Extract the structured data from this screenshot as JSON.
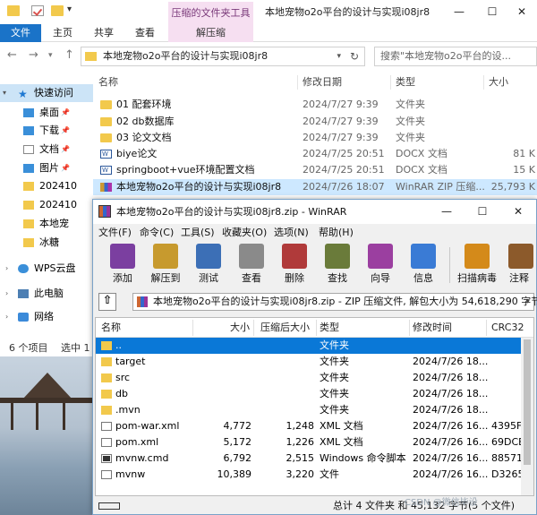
{
  "explorer": {
    "title": "本地宠物o2o平台的设计与实现i08jr8",
    "ribbon": {
      "context_title": "压缩的文件夹工具",
      "tabs": [
        "文件",
        "主页",
        "共享",
        "查看",
        "解压缩"
      ]
    },
    "address": {
      "path": "本地宠物o2o平台的设计与实现i08jr8"
    },
    "search_placeholder": "搜索\"本地宠物o2o平台的设...",
    "nav_items": [
      {
        "label": "快速访问",
        "icon": "star-icon",
        "pinned": false
      },
      {
        "label": "桌面",
        "icon": "desktop-icon",
        "pinned": true
      },
      {
        "label": "下载",
        "icon": "download-icon",
        "pinned": true
      },
      {
        "label": "文档",
        "icon": "document-icon",
        "pinned": true
      },
      {
        "label": "图片",
        "icon": "picture-icon",
        "pinned": true
      },
      {
        "label": "202410",
        "icon": "folder-icon",
        "pinned": false
      },
      {
        "label": "202410",
        "icon": "folder-icon",
        "pinned": false
      },
      {
        "label": "本地宠",
        "icon": "folder-icon",
        "pinned": false
      },
      {
        "label": "冰糖",
        "icon": "folder-icon",
        "pinned": false
      },
      {
        "label": "WPS云盘",
        "icon": "cloud-icon",
        "pinned": false
      },
      {
        "label": "此电脑",
        "icon": "computer-icon",
        "pinned": false
      },
      {
        "label": "网络",
        "icon": "network-icon",
        "pinned": false
      }
    ],
    "columns": {
      "name": "名称",
      "date": "修改日期",
      "type": "类型",
      "size": "大小"
    },
    "files": [
      {
        "name": "01 配套环境",
        "date": "2024/7/27 9:39",
        "type": "文件夹",
        "size": "",
        "kind": "folder"
      },
      {
        "name": "02 db数据库",
        "date": "2024/7/27 9:39",
        "type": "文件夹",
        "size": "",
        "kind": "folder"
      },
      {
        "name": "03 论文文档",
        "date": "2024/7/27 9:39",
        "type": "文件夹",
        "size": "",
        "kind": "folder"
      },
      {
        "name": "biye论文",
        "date": "2024/7/25 20:51",
        "type": "DOCX 文档",
        "size": "81 K",
        "kind": "docx"
      },
      {
        "name": "springboot+vue环境配置文档",
        "date": "2024/7/25 20:51",
        "type": "DOCX 文档",
        "size": "15 K",
        "kind": "docx"
      },
      {
        "name": "本地宠物o2o平台的设计与实现i08jr8",
        "date": "2024/7/26 18:07",
        "type": "WinRAR ZIP 压缩...",
        "size": "25,793 K",
        "kind": "zip"
      }
    ],
    "status": {
      "count": "6 个项目",
      "selected": "选中 1"
    }
  },
  "winrar": {
    "title": "本地宠物o2o平台的设计与实现i08jr8.zip - WinRAR",
    "menu": [
      "文件(F)",
      "命令(C)",
      "工具(S)",
      "收藏夹(O)",
      "选项(N)",
      "帮助(H)"
    ],
    "tools": [
      {
        "label": "添加",
        "icon": "add-archive-icon",
        "color": "#7b3fa0"
      },
      {
        "label": "解压到",
        "icon": "extract-to-icon",
        "color": "#c79a2e"
      },
      {
        "label": "测试",
        "icon": "test-icon",
        "color": "#3c6fb6"
      },
      {
        "label": "查看",
        "icon": "view-icon",
        "color": "#8a8a8a"
      },
      {
        "label": "删除",
        "icon": "delete-icon",
        "color": "#b03a3a"
      },
      {
        "label": "查找",
        "icon": "find-icon",
        "color": "#6a7b3a"
      },
      {
        "label": "向导",
        "icon": "wizard-icon",
        "color": "#9b3fa0"
      },
      {
        "label": "信息",
        "icon": "info-icon",
        "color": "#3a7bd5"
      },
      {
        "label": "扫描病毒",
        "icon": "scan-virus-icon",
        "color": "#d48a1a"
      },
      {
        "label": "注释",
        "icon": "comment-icon",
        "color": "#8c5a2b"
      }
    ],
    "path": "本地宠物o2o平台的设计与实现i08jr8.zip - ZIP 压缩文件, 解包大小为 54,618,290 字节",
    "columns": {
      "name": "名称",
      "size": "大小",
      "packed": "压缩后大小",
      "type": "类型",
      "modified": "修改时间",
      "crc": "CRC32"
    },
    "rows": [
      {
        "name": "..",
        "size": "",
        "packed": "",
        "type": "文件夹",
        "modified": "",
        "crc": "",
        "kind": "folder",
        "selected": true
      },
      {
        "name": "target",
        "size": "",
        "packed": "",
        "type": "文件夹",
        "modified": "2024/7/26 18...",
        "crc": "",
        "kind": "folder",
        "selected": false
      },
      {
        "name": "src",
        "size": "",
        "packed": "",
        "type": "文件夹",
        "modified": "2024/7/26 18...",
        "crc": "",
        "kind": "folder",
        "selected": false
      },
      {
        "name": "db",
        "size": "",
        "packed": "",
        "type": "文件夹",
        "modified": "2024/7/26 18...",
        "crc": "",
        "kind": "folder",
        "selected": false
      },
      {
        "name": ".mvn",
        "size": "",
        "packed": "",
        "type": "文件夹",
        "modified": "2024/7/26 18...",
        "crc": "",
        "kind": "folder",
        "selected": false
      },
      {
        "name": "pom-war.xml",
        "size": "4,772",
        "packed": "1,248",
        "type": "XML 文档",
        "modified": "2024/7/26 16...",
        "crc": "4395F",
        "kind": "xml",
        "selected": false
      },
      {
        "name": "pom.xml",
        "size": "5,172",
        "packed": "1,226",
        "type": "XML 文档",
        "modified": "2024/7/26 16...",
        "crc": "69DCE",
        "kind": "xml",
        "selected": false
      },
      {
        "name": "mvnw.cmd",
        "size": "6,792",
        "packed": "2,515",
        "type": "Windows 命令脚本",
        "modified": "2024/7/26 16...",
        "crc": "88571",
        "kind": "cmd",
        "selected": false
      },
      {
        "name": "mvnw",
        "size": "10,389",
        "packed": "3,220",
        "type": "文件",
        "modified": "2024/7/26 16...",
        "crc": "D3265",
        "kind": "file",
        "selected": false
      }
    ],
    "status": "总计 4 文件夹 和 45,132 字节(5 个文件)"
  },
  "watermark": "CSDN @微信毕设"
}
